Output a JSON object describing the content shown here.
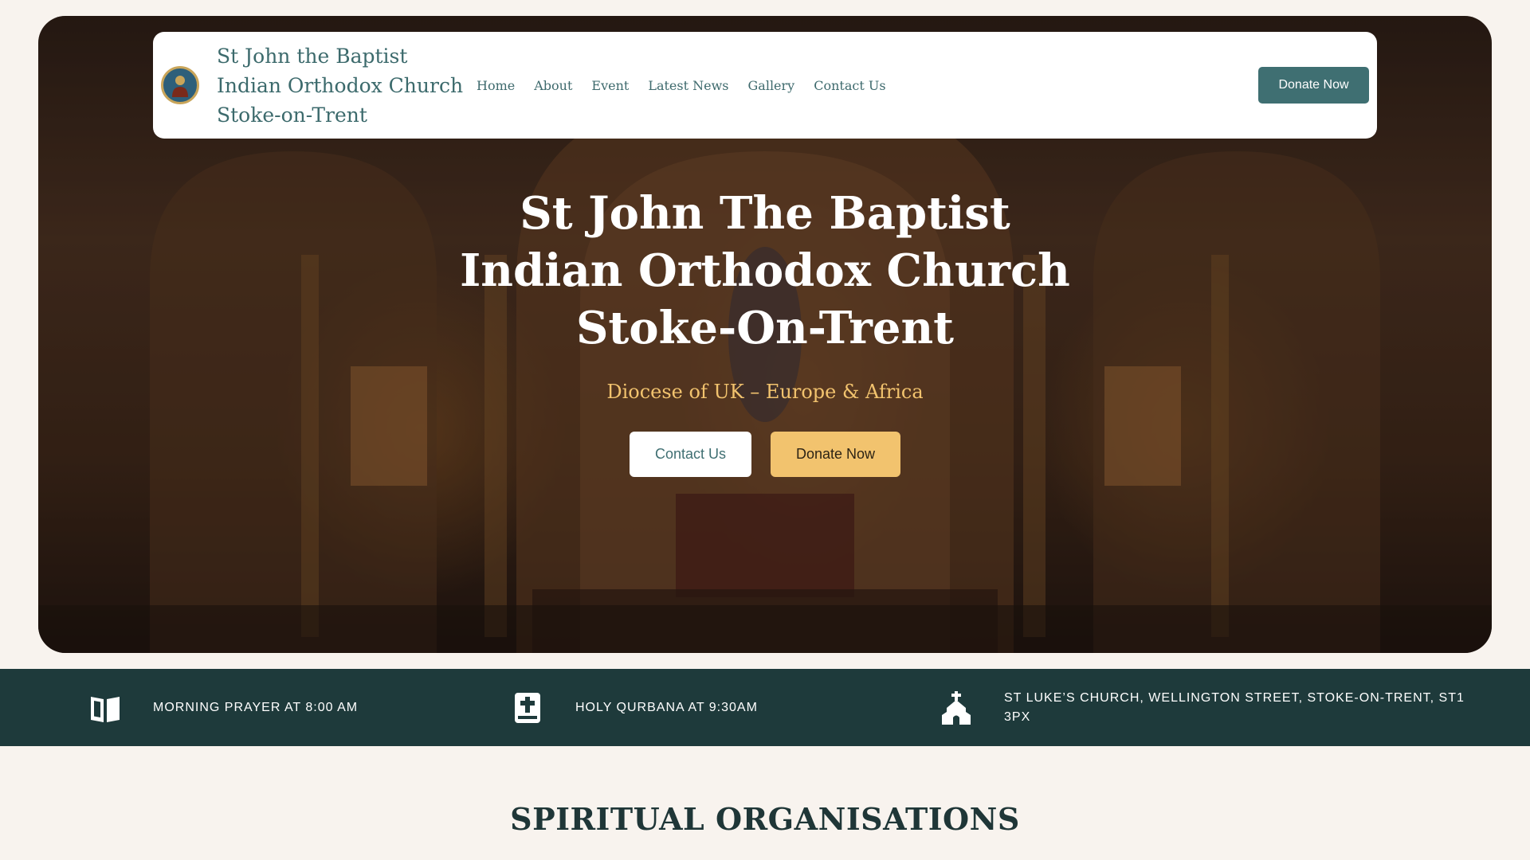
{
  "header": {
    "site_title_lines": [
      "St John the Baptist",
      "Indian Orthodox Church",
      "Stoke-on-Trent"
    ],
    "logo_icon": "church-logo-icon",
    "nav": [
      "Home",
      "About",
      "Event",
      "Latest News",
      "Gallery",
      "Contact Us"
    ],
    "donate_label": "Donate Now"
  },
  "hero": {
    "title": "St John The Baptist Indian Orthodox Church Stoke-On-Trent",
    "subtitle": "Diocese of UK – Europe & Africa",
    "contact_label": "Contact Us",
    "donate_label": "Donate Now"
  },
  "info_bar": [
    {
      "icon": "book-icon",
      "text": "Morning Prayer at 8:00 AM"
    },
    {
      "icon": "bible-icon",
      "text": "Holy Qurbana at 9:30AM"
    },
    {
      "icon": "church-icon",
      "text": "St Luke’s Church, Wellington Street, Stoke-on-Trent, ST1 3PX"
    }
  ],
  "section": {
    "title": "SPIRITUAL ORGANISATIONS"
  },
  "colors": {
    "accent_teal": "#3f6f72",
    "info_bar_bg": "#1e3a3b",
    "gold": "#f2c36e",
    "page_bg": "#f8f3ee"
  }
}
